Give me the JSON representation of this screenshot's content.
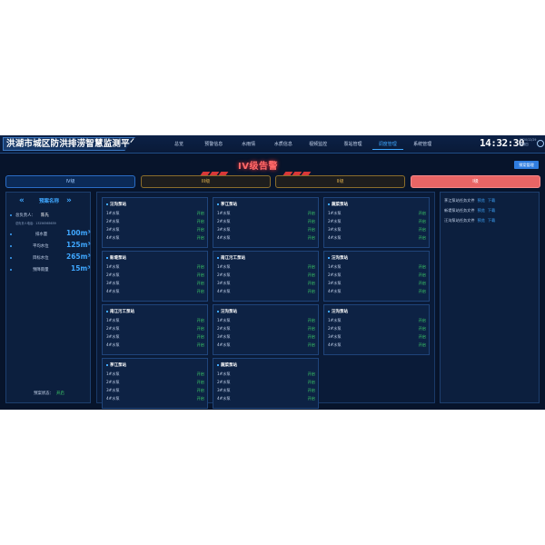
{
  "app": {
    "title": "洪湖市城区防洪排涝智慧监测平台",
    "clock": "14:32:30",
    "date_line1": "2020/12/29",
    "date_line2": "星期四"
  },
  "nav": {
    "items": [
      "总览",
      "预警信息",
      "水雨情",
      "水质信息",
      "视频监控",
      "泵站管理",
      "调度管理",
      "系统管理"
    ],
    "active": "调度管理"
  },
  "warning": {
    "title": "IV级告警",
    "plan_button": "预案管理"
  },
  "levels": {
    "iv": "IV级",
    "iii": "III级",
    "ii": "II级",
    "i": "I级"
  },
  "left_panel": {
    "plan_name_label": "预案名称",
    "leader_label": "总负责人：",
    "leader_name": "陈先",
    "contact": "总负责人电话：13256565659",
    "metrics": [
      {
        "label": "排水量",
        "value": "100m³"
      },
      {
        "label": "平均水位",
        "value": "125m³"
      },
      {
        "label": "目标水位",
        "value": "265m³"
      },
      {
        "label": "预降雨量",
        "value": "15m³"
      }
    ],
    "status_label": "预案状态：",
    "status_value": "开启"
  },
  "stations": [
    {
      "name": "汪沟泵站",
      "pumps": [
        {
          "name": "1#水泵",
          "state": "开启"
        },
        {
          "name": "2#水泵",
          "state": "开启"
        },
        {
          "name": "3#水泵",
          "state": "开启"
        },
        {
          "name": "4#水泵",
          "state": "开启"
        }
      ]
    },
    {
      "name": "茅江泵站",
      "pumps": [
        {
          "name": "1#水泵",
          "state": "开启"
        },
        {
          "name": "2#水泵",
          "state": "开启"
        },
        {
          "name": "3#水泵",
          "state": "开启"
        },
        {
          "name": "4#水泵",
          "state": "开启"
        }
      ]
    },
    {
      "name": "蔬菜泵站",
      "pumps": [
        {
          "name": "1#水泵",
          "state": "开启"
        },
        {
          "name": "2#水泵",
          "state": "开启"
        },
        {
          "name": "3#水泵",
          "state": "开启"
        },
        {
          "name": "4#水泵",
          "state": "开启"
        }
      ]
    },
    {
      "name": "新堤泵站",
      "pumps": [
        {
          "name": "1#水泵",
          "state": "开启"
        },
        {
          "name": "2#水泵",
          "state": "开启"
        },
        {
          "name": "3#水泵",
          "state": "开启"
        },
        {
          "name": "4#水泵",
          "state": "开启"
        }
      ]
    },
    {
      "name": "南江污工泵站",
      "pumps": [
        {
          "name": "1#水泵",
          "state": "开启"
        },
        {
          "name": "2#水泵",
          "state": "开启"
        },
        {
          "name": "3#水泵",
          "state": "开启"
        },
        {
          "name": "4#水泵",
          "state": "开启"
        }
      ]
    },
    {
      "name": "汪沟泵站",
      "pumps": [
        {
          "name": "1#水泵",
          "state": "开启"
        },
        {
          "name": "2#水泵",
          "state": "开启"
        },
        {
          "name": "3#水泵",
          "state": "开启"
        },
        {
          "name": "4#水泵",
          "state": "开启"
        }
      ]
    },
    {
      "name": "南江污工泵站",
      "pumps": [
        {
          "name": "1#水泵",
          "state": "开启"
        },
        {
          "name": "2#水泵",
          "state": "开启"
        },
        {
          "name": "3#水泵",
          "state": "开启"
        },
        {
          "name": "4#水泵",
          "state": "开启"
        }
      ]
    },
    {
      "name": "汪沟泵站",
      "pumps": [
        {
          "name": "1#水泵",
          "state": "开启"
        },
        {
          "name": "2#水泵",
          "state": "开启"
        },
        {
          "name": "3#水泵",
          "state": "开启"
        },
        {
          "name": "4#水泵",
          "state": "开启"
        }
      ]
    },
    {
      "name": "汪沟泵站",
      "pumps": [
        {
          "name": "1#水泵",
          "state": "开启"
        },
        {
          "name": "2#水泵",
          "state": "开启"
        },
        {
          "name": "3#水泵",
          "state": "开启"
        },
        {
          "name": "4#水泵",
          "state": "开启"
        }
      ]
    },
    {
      "name": "茅江泵站",
      "pumps": [
        {
          "name": "1#水泵",
          "state": "开启"
        },
        {
          "name": "2#水泵",
          "state": "开启"
        },
        {
          "name": "3#水泵",
          "state": "开启"
        },
        {
          "name": "4#水泵",
          "state": "开启"
        }
      ]
    },
    {
      "name": "蔬菜泵站",
      "pumps": [
        {
          "name": "1#水泵",
          "state": "开启"
        },
        {
          "name": "2#水泵",
          "state": "开启"
        },
        {
          "name": "3#水泵",
          "state": "开启"
        },
        {
          "name": "4#水泵",
          "state": "开启"
        }
      ]
    }
  ],
  "right_panel": {
    "files": [
      {
        "name": "茅江泵站任务文件",
        "preview": "预览",
        "download": "下载"
      },
      {
        "name": "新堤泵站任务文件",
        "preview": "预览",
        "download": "下载"
      },
      {
        "name": "汪沟泵站任务文件",
        "preview": "预览",
        "download": "下载"
      }
    ]
  },
  "colors": {
    "background": "#07142b",
    "accent": "#3fa7ff",
    "alert_red": "#e86565",
    "on_green": "#3fdc6a"
  }
}
